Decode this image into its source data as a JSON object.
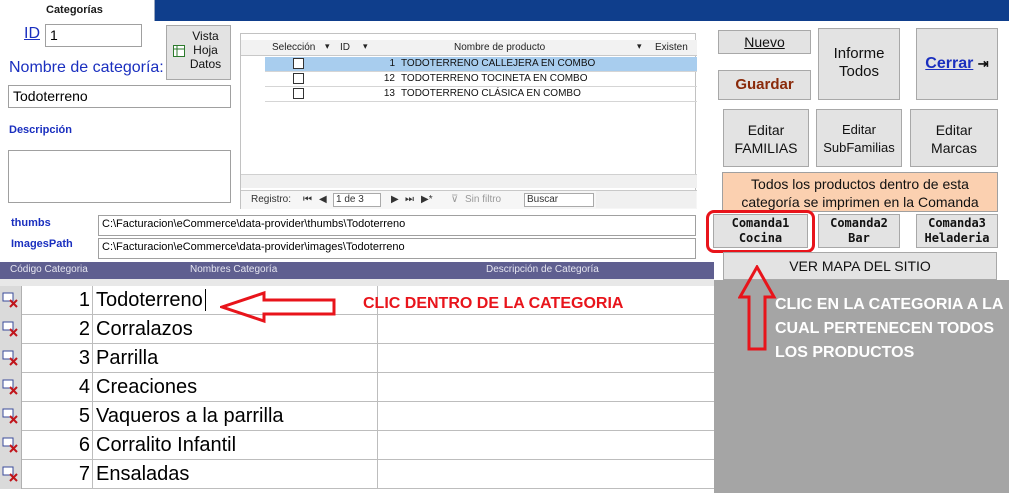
{
  "tab": {
    "label": "Categorías"
  },
  "form": {
    "id_label": "ID",
    "id_value": "1",
    "vista_label": "Vista Hoja Datos",
    "nombre_label": "Nombre de categoría:",
    "nombre_value": "Todoterreno",
    "descripcion_label": "Descripción",
    "descripcion_value": "",
    "thumbs_label": "thumbs",
    "thumbs_value": "C:\\Facturacion\\eCommerce\\data-provider\\thumbs\\Todoterreno",
    "images_label": "ImagesPath",
    "images_value": "C:\\Facturacion\\eCommerce\\data-provider\\images\\Todoterreno"
  },
  "subform": {
    "columns": [
      "Selección",
      "ID",
      "Nombre de producto",
      "Existen"
    ],
    "rows": [
      {
        "id": "1",
        "name": "TODOTERRENO CALLEJERA EN COMBO"
      },
      {
        "id": "12",
        "name": "TODOTERRENO TOCINETA EN COMBO"
      },
      {
        "id": "13",
        "name": "TODOTERRENO CLÁSICA EN COMBO"
      }
    ],
    "nav_label": "Registro:",
    "nav_position": "1 de 3",
    "nav_filter": "Sin filtro",
    "nav_search": "Buscar"
  },
  "buttons": {
    "nuevo": "Nuevo",
    "guardar": "Guardar",
    "informe": "Informe Todos",
    "cerrar": "Cerrar",
    "familias": "Editar FAMILIAS",
    "subfamilias": "Editar SubFamilias",
    "marcas": "Editar Marcas",
    "comanda1": "Comanda1 Cocina",
    "comanda2": "Comanda2 Bar",
    "comanda3": "Comanda3 Heladeria",
    "mapa": "VER MAPA DEL SITIO"
  },
  "info_text": "Todos los productos dentro de esta categoría se imprimen en la Comanda",
  "list": {
    "headers": [
      "Código Categoria",
      "Nombres Categoría",
      "Descripción de Categoría"
    ],
    "rows": [
      {
        "num": "1",
        "name": "Todoterreno"
      },
      {
        "num": "2",
        "name": "Corralazos"
      },
      {
        "num": "3",
        "name": "Parrilla"
      },
      {
        "num": "4",
        "name": "Creaciones"
      },
      {
        "num": "5",
        "name": "Vaqueros a la parrilla"
      },
      {
        "num": "6",
        "name": "Corralito Infantil"
      },
      {
        "num": "7",
        "name": "Ensaladas"
      }
    ]
  },
  "annotations": {
    "left": "CLIC DENTRO DE LA CATEGORIA",
    "right": "CLIC EN LA CATEGORIA A LA CUAL PERTENECEN TODOS LOS PRODUCTOS"
  },
  "colors": {
    "topbar": "#0f3e8c",
    "info_bg": "#fbd0b0",
    "annotation_red": "#e8141b",
    "header_bar": "#5f5f90"
  }
}
